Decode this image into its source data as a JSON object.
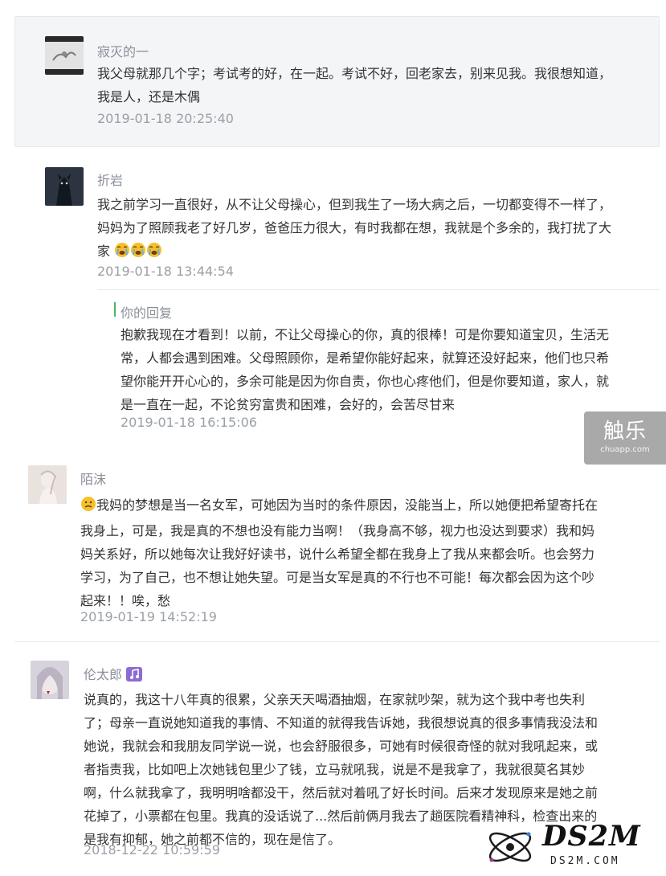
{
  "comments": [
    {
      "user": "寂灭的一",
      "lines": [
        "我父母就那几个字；考试考的好，在一起。考试不好，回老家去，别来见我。我很想知道，",
        "我是人，还是木偶"
      ],
      "time": "2019-01-18 20:25:40"
    },
    {
      "user": "折岩",
      "lines": [
        "我之前学习一直很好，从不让父母操心，但到我生了一场大病之后，一切都变得不一样了，",
        "妈妈为了照顾我老了好几岁，爸爸压力很大，有时我都在想，我就是个多余的，我打扰了大",
        "家"
      ],
      "time": "2019-01-18 13:44:54",
      "reply": {
        "label": "你的回复",
        "lines": [
          "抱歉我现在才看到！以前，不让父母操心的你，真的很棒！可是你要知道宝贝，生活无",
          "常，人都会遇到困难。父母照顾你，是希望你能好起来，就算还没好起来，他们也只希",
          "望你能开开心心的，多余可能是因为你自责，你也心疼他们，但是你要知道，家人，就",
          "是一直在一起，不论贫穷富贵和困难，会好的，会苦尽甘来"
        ],
        "time": "2019-01-18 16:15:06"
      }
    },
    {
      "user": "陌沫",
      "lines": [
        "我妈的梦想是当一名女军，可她因为当时的条件原因，没能当上，所以她便把希望寄托在",
        "我身上，可是，我是真的不想也没有能力当啊！（我身高不够，视力也没达到要求）我和妈",
        "妈关系好，所以她每次让我好好读书，说什么希望全都在我身上了我从来都会听。也会努力",
        "学习，为了自己，也不想让她失望。可是当女军是真的不行也不可能！每次都会因为这个吵",
        "起来！！唉，愁"
      ],
      "time": "2019-01-19 14:52:19"
    },
    {
      "user": "伦太郎",
      "lines": [
        "说真的，我这十八年真的很累，父亲天天喝酒抽烟，在家就吵架，就为这个我中考也失利",
        "了；母亲一直说她知道我的事情、不知道的就得我告诉她，我很想说真的很多事情我没法和",
        "她说，我就会和我朋友同学说一说，也会舒服很多，可她有时候很奇怪的就对我吼起来，或",
        "者指责我，比如吧上次她钱包里少了钱，立马就吼我，说是不是我拿了，我就很莫名其妙",
        "啊，什么就我拿了，我明明啥都没干，然后就对着吼了好长时间。后来才发现原来是她之前",
        "花掉了，小票都在包里。我真的没话说了...然后前俩月我去了趟医院看精神科，检查出来的",
        "是我有抑郁，她之前都不信的，现在是信了。"
      ],
      "time": "2018-12-22 10:59:59"
    }
  ],
  "watermark": {
    "main": "触乐",
    "sub": "chuapp.com"
  },
  "logo": {
    "main": "DS2M",
    "sub": "DS2M.COM"
  },
  "colors": {
    "username": "#8a8f99",
    "timestamp": "#9aa0a8",
    "reply_bar": "#46b664",
    "highlight_bg": "#f4f5f7"
  }
}
